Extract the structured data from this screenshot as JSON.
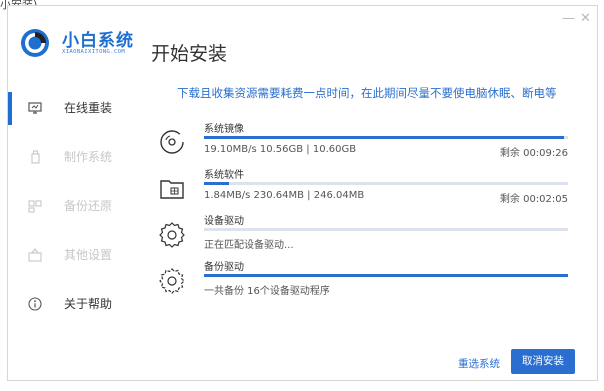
{
  "top_caption": "小安装)",
  "window_controls": {
    "minimize": "—",
    "close": "✕"
  },
  "brand": {
    "name": "小白系统",
    "subtitle": "XIAOBAIXITONG.COM"
  },
  "page_title": "开始安装",
  "sidebar": {
    "items": [
      {
        "label": "在线重装",
        "icon": "monitor-icon",
        "active": true
      },
      {
        "label": "制作系统",
        "icon": "usb-drive-icon",
        "active": false
      },
      {
        "label": "备份还原",
        "icon": "backup-icon",
        "active": false
      },
      {
        "label": "其他设置",
        "icon": "settings-box-icon",
        "active": false
      },
      {
        "label": "关于帮助",
        "icon": "info-icon",
        "active": false
      }
    ]
  },
  "notice": "下载且收集资源需要耗费一点时间，在此期间尽量不要使电脑休眠、断电等",
  "tasks": [
    {
      "name": "系统镜像",
      "icon": "disc-icon",
      "detail": "19.10MB/s 10.56GB | 10.60GB",
      "remaining": "剩余 00:09:26",
      "progress": 0.99
    },
    {
      "name": "系统软件",
      "icon": "folder-icon",
      "detail": "1.84MB/s 230.64MB | 246.04MB",
      "remaining": "剩余 00:02:05",
      "progress": 0.07
    },
    {
      "name": "设备驱动",
      "icon": "gear-icon",
      "detail": "正在匹配设备驱动...",
      "remaining": "",
      "progress": 0
    },
    {
      "name": "备份驱动",
      "icon": "gear-icon",
      "detail": "一共备份 16个设备驱动程序",
      "remaining": "",
      "progress": 1.0
    }
  ],
  "buttons": {
    "reselect": "重选系统",
    "cancel": "取消安装"
  },
  "colors": {
    "accent": "#2a6fcf",
    "brand": "#1e6fd0",
    "track": "#dde3ec",
    "inactive_text": "#c7c7c7"
  }
}
